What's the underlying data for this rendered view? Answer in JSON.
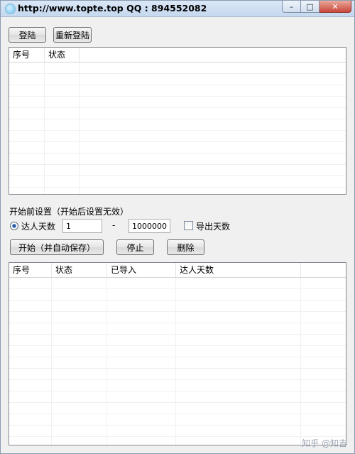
{
  "window": {
    "title": "http://www.topte.top  QQ : 894552082",
    "controls": {
      "minimize": "–",
      "maximize": "□",
      "close": "✕"
    }
  },
  "toolbar": {
    "login_label": "登陆",
    "relogin_label": "重新登陆"
  },
  "account_table": {
    "columns": [
      "序号",
      "状态",
      ""
    ]
  },
  "settings": {
    "section_label": "开始前设置（开始后设置无效）",
    "radio_label": "达人天数",
    "radio_checked": true,
    "min_value": "1",
    "range_separator": "-",
    "max_value": "1000000",
    "export_days_label": "导出天数",
    "export_days_checked": false
  },
  "actions": {
    "start_label": "开始（并自动保存）",
    "stop_label": "停止",
    "delete_label": "删除"
  },
  "result_table": {
    "columns": [
      "序号",
      "状态",
      "已导入",
      "达人天数",
      ""
    ]
  },
  "watermark": "知乎 @知吉"
}
